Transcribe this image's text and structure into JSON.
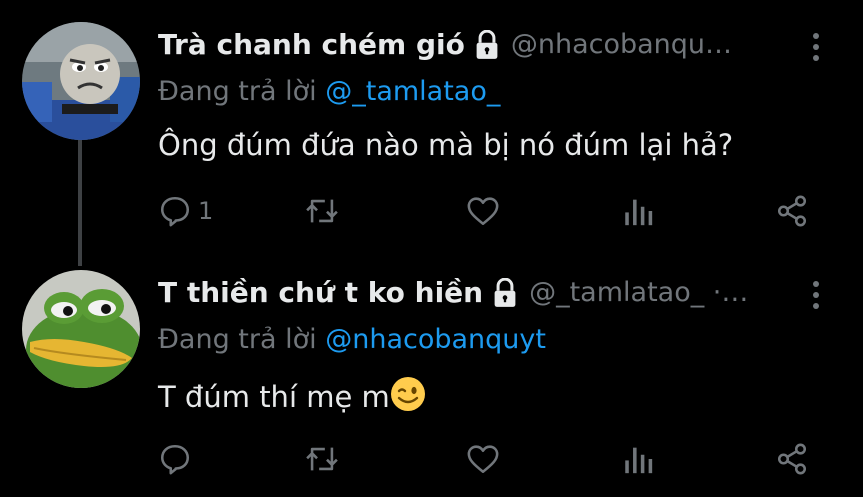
{
  "tweets": [
    {
      "display_name": "Trà chanh chém gió",
      "handle": "@nhacobanqu…",
      "reply_prefix": "Đang trả lời",
      "reply_to": "@_tamlatao_",
      "text": "Ông đúm đứa nào mà bị nó đúm lại hả?",
      "reply_count": "1",
      "avatar_icon": "train-face-avatar",
      "locked": true
    },
    {
      "display_name": "T thiền chứ t ko hiền",
      "handle": "@_tamlatao_ ·…",
      "reply_prefix": "Đang trả lời",
      "reply_to": "@nhacobanquyt",
      "text": "T đúm thí mẹ m",
      "emoji": "winking-face",
      "reply_count": "",
      "avatar_icon": "frog-avatar",
      "locked": true
    }
  ],
  "colors": {
    "background": "#000000",
    "text": "#e7e9ea",
    "secondary": "#71767b",
    "link": "#1d9bf0",
    "thread_line": "#3e4144"
  }
}
